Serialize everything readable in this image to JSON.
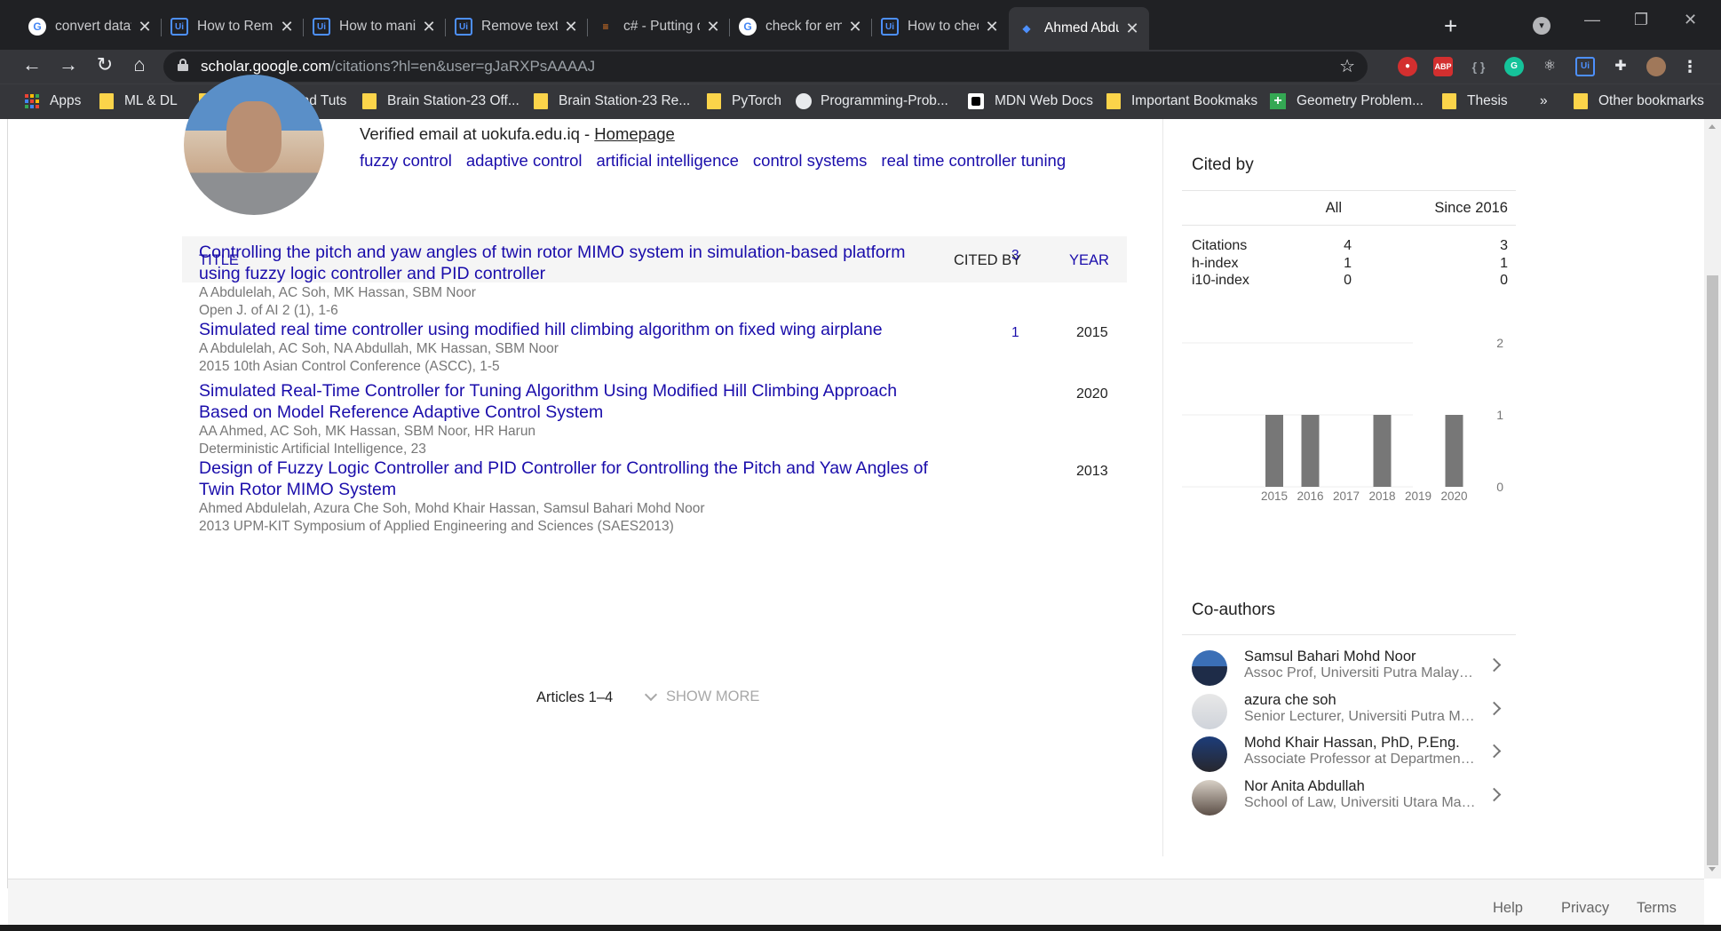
{
  "browser": {
    "tabs": [
      {
        "title": "convert datatable",
        "icon": "google-icon"
      },
      {
        "title": "How to Remove",
        "icon": "uipath-icon"
      },
      {
        "title": "How to manipulat",
        "icon": "uipath-icon"
      },
      {
        "title": "Remove text from",
        "icon": "uipath-icon"
      },
      {
        "title": "c# - Putting datat",
        "icon": "stackoverflow-icon"
      },
      {
        "title": "check for empty s",
        "icon": "google-icon"
      },
      {
        "title": "How to check if a",
        "icon": "uipath-icon"
      },
      {
        "title": "Ahmed Abdulelah",
        "icon": "scholar-icon",
        "active": true
      }
    ],
    "url": {
      "host": "scholar.google.com",
      "path": "/citations?hl=en&user=gJaRXPsAAAAJ"
    },
    "extensions": [
      "ABP"
    ],
    "bookmarks": [
      {
        "label": "Apps",
        "icon": "apps-grid-icon"
      },
      {
        "label": "ML & DL",
        "icon": "folder-icon"
      },
      {
        "label": "NLP Notes and Tuts",
        "icon": "folder-icon"
      },
      {
        "label": "Brain Station-23 Off...",
        "icon": "folder-icon"
      },
      {
        "label": "Brain Station-23 Re...",
        "icon": "folder-icon"
      },
      {
        "label": "PyTorch",
        "icon": "folder-icon"
      },
      {
        "label": "Programming-Prob...",
        "icon": "github-icon"
      },
      {
        "label": "MDN Web Docs",
        "icon": "mdn-icon"
      },
      {
        "label": "Important Bookmaks",
        "icon": "folder-icon"
      },
      {
        "label": "Geometry Problem...",
        "icon": "plus-icon"
      },
      {
        "label": "Thesis",
        "icon": "folder-icon"
      }
    ],
    "overflow": "»",
    "other_bookmarks": "Other bookmarks"
  },
  "profile": {
    "verified": "Verified email at uokufa.edu.iq -",
    "homepage": "Homepage",
    "interests": [
      "fuzzy control",
      "adaptive control",
      "artificial intelligence",
      "control systems",
      "real time controller tuning"
    ]
  },
  "table": {
    "headers": {
      "title": "TITLE",
      "cited_by": "CITED BY",
      "year": "YEAR"
    },
    "articles": [
      {
        "title": "Controlling the pitch and yaw angles of twin rotor MIMO system in simulation-based platform using fuzzy logic controller and PID controller",
        "authors": "A Abdulelah, AC Soh, MK Hassan, SBM Noor",
        "venue": "Open J. of AI 2 (1), 1-6",
        "cited_by": "3",
        "year": ""
      },
      {
        "title": "Simulated real time controller using modified hill climbing algorithm on fixed wing airplane",
        "authors": "A Abdulelah, AC Soh, NA Abdullah, MK Hassan, SBM Noor",
        "venue": "2015 10th Asian Control Conference (ASCC), 1-5",
        "cited_by": "1",
        "year": "2015"
      },
      {
        "title": "Simulated Real-Time Controller for Tuning Algorithm Using Modified Hill Climbing Approach Based on Model Reference Adaptive Control System",
        "authors": "AA Ahmed, AC Soh, MK Hassan, SBM Noor, HR Harun",
        "venue": "Deterministic Artificial Intelligence, 23",
        "cited_by": "",
        "year": "2020"
      },
      {
        "title": "Design of Fuzzy Logic Controller and PID Controller for Controlling the Pitch and Yaw Angles of Twin Rotor MIMO System",
        "authors": "Ahmed Abdulelah, Azura Che Soh, Mohd Khair Hassan, Samsul Bahari Mohd Noor",
        "venue": "2013 UPM-KIT Symposium of Applied Engineering and Sciences (SAES2013)",
        "cited_by": "",
        "year": "2013"
      }
    ],
    "articles_count": "Articles 1–4",
    "show_more": "SHOW MORE"
  },
  "cited_by": {
    "title": "Cited by",
    "col_all": "All",
    "col_since": "Since 2016",
    "metrics": [
      {
        "label": "Citations",
        "all": "4",
        "since": "3"
      },
      {
        "label": "h-index",
        "all": "1",
        "since": "1"
      },
      {
        "label": "i10-index",
        "all": "0",
        "since": "0"
      }
    ]
  },
  "chart_data": {
    "type": "bar",
    "categories": [
      "2015",
      "2016",
      "2017",
      "2018",
      "2019",
      "2020"
    ],
    "values": [
      1,
      1,
      0,
      1,
      0,
      1
    ],
    "ylim": [
      0,
      2
    ],
    "yticks": [
      0,
      1,
      2
    ],
    "bar_color": "#777777",
    "grid": true
  },
  "coauthors": {
    "title": "Co-authors",
    "items": [
      {
        "name": "Samsul Bahari Mohd Noor",
        "affiliation": "Assoc Prof, Universiti Putra Malaysia"
      },
      {
        "name": "azura che soh",
        "affiliation": "Senior Lecturer, Universiti Putra Malaysia"
      },
      {
        "name": "Mohd Khair Hassan, PhD, P.Eng.",
        "affiliation": "Associate Professor at Department of Electrical"
      },
      {
        "name": "Nor Anita Abdullah",
        "affiliation": "School of Law, Universiti Utara Malaysia"
      }
    ]
  },
  "footer": {
    "help": "Help",
    "privacy": "Privacy",
    "terms": "Terms"
  },
  "colors": {
    "link": "#1a0dab",
    "accent_green": "#34a853",
    "tabbar": "#202124",
    "toolbar": "#35363a"
  }
}
